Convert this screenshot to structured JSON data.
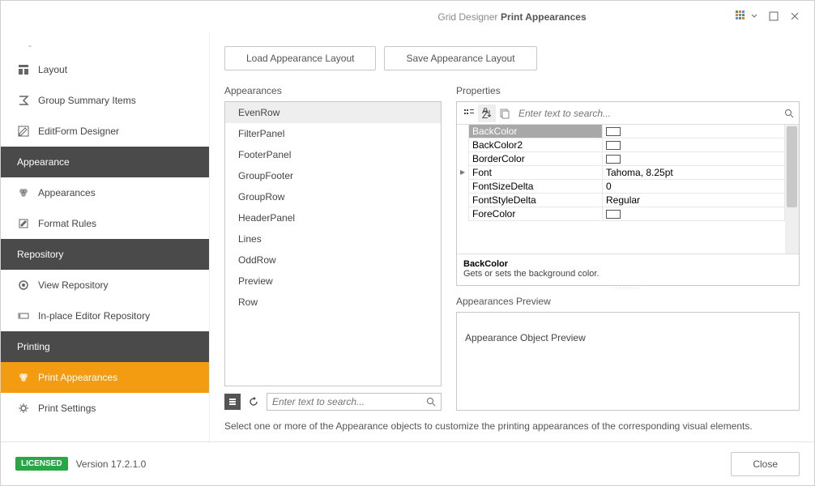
{
  "title_prefix": "Grid Designer",
  "title_main": "Print Appearances",
  "sidebar": {
    "items": [
      {
        "kind": "item",
        "label": "Layout"
      },
      {
        "kind": "item",
        "label": "Group Summary Items"
      },
      {
        "kind": "item",
        "label": "EditForm Designer"
      },
      {
        "kind": "cat",
        "label": "Appearance"
      },
      {
        "kind": "item",
        "label": "Appearances"
      },
      {
        "kind": "item",
        "label": "Format Rules"
      },
      {
        "kind": "cat",
        "label": "Repository"
      },
      {
        "kind": "item",
        "label": "View Repository"
      },
      {
        "kind": "item",
        "label": "In-place Editor Repository"
      },
      {
        "kind": "cat",
        "label": "Printing"
      },
      {
        "kind": "item",
        "label": "Print Appearances",
        "selected": true
      },
      {
        "kind": "item",
        "label": "Print Settings"
      }
    ]
  },
  "toolbar": {
    "load": "Load Appearance Layout",
    "save": "Save Appearance Layout"
  },
  "headers": {
    "appearances": "Appearances",
    "properties": "Properties",
    "preview": "Appearances Preview"
  },
  "appearances": [
    "EvenRow",
    "FilterPanel",
    "FooterPanel",
    "GroupFooter",
    "GroupRow",
    "HeaderPanel",
    "Lines",
    "OddRow",
    "Preview",
    "Row"
  ],
  "appearances_selected": "EvenRow",
  "search_placeholder": "Enter text to search...",
  "properties": [
    {
      "name": "BackColor",
      "value": "",
      "swatch": true
    },
    {
      "name": "BackColor2",
      "value": "",
      "swatch": true
    },
    {
      "name": "BorderColor",
      "value": "",
      "swatch": true
    },
    {
      "name": "Font",
      "value": "Tahoma, 8.25pt",
      "expando": "▸"
    },
    {
      "name": "FontSizeDelta",
      "value": "0"
    },
    {
      "name": "FontStyleDelta",
      "value": "Regular"
    },
    {
      "name": "ForeColor",
      "value": "",
      "swatch": true
    }
  ],
  "properties_selected": "BackColor",
  "desc": {
    "name": "BackColor",
    "text": "Gets or sets the background color."
  },
  "preview_text": "Appearance Object Preview",
  "hint": "Select one or more of the Appearance objects to customize the printing appearances of the corresponding visual elements.",
  "footer": {
    "license": "LICENSED",
    "version": "Version 17.2.1.0",
    "close": "Close"
  }
}
